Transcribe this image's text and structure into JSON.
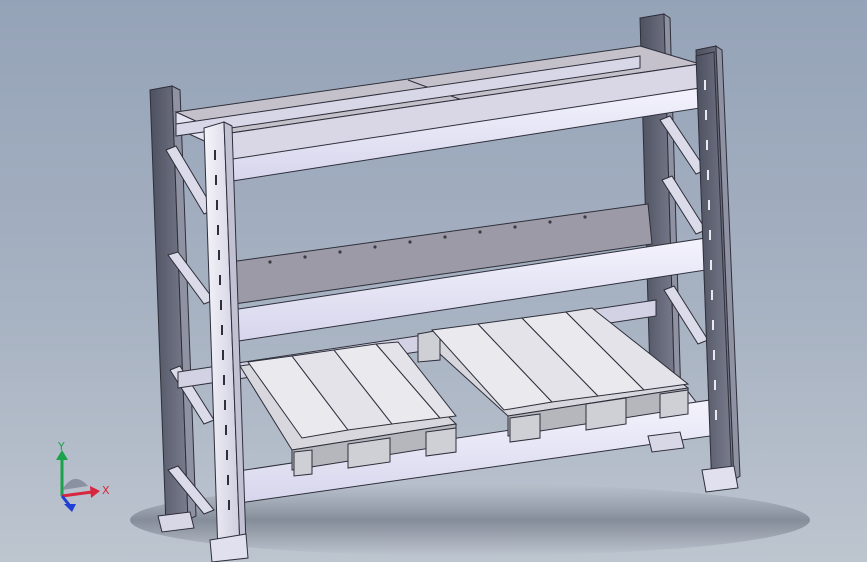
{
  "viewport": {
    "background_top": "#95a3b8",
    "background_bottom": "#bdc5cf"
  },
  "model": {
    "name_icon": "pallet-rack-model",
    "colors": {
      "upright_dark": "#5f6273",
      "upright_light": "#ecebf6",
      "beam": "#e7e6f8",
      "beam_shadow": "#b9b8cf",
      "shelf_panel": "#c9c6cf",
      "pallet": "#e8e8ec",
      "pallet_shadow": "#b6b6bd",
      "edge": "#2e2f3a"
    }
  },
  "triad": {
    "x_label": "X",
    "y_label": "Y",
    "x_color": "#d7263d",
    "y_color": "#1aa34a",
    "z_color": "#1f3fd6"
  }
}
